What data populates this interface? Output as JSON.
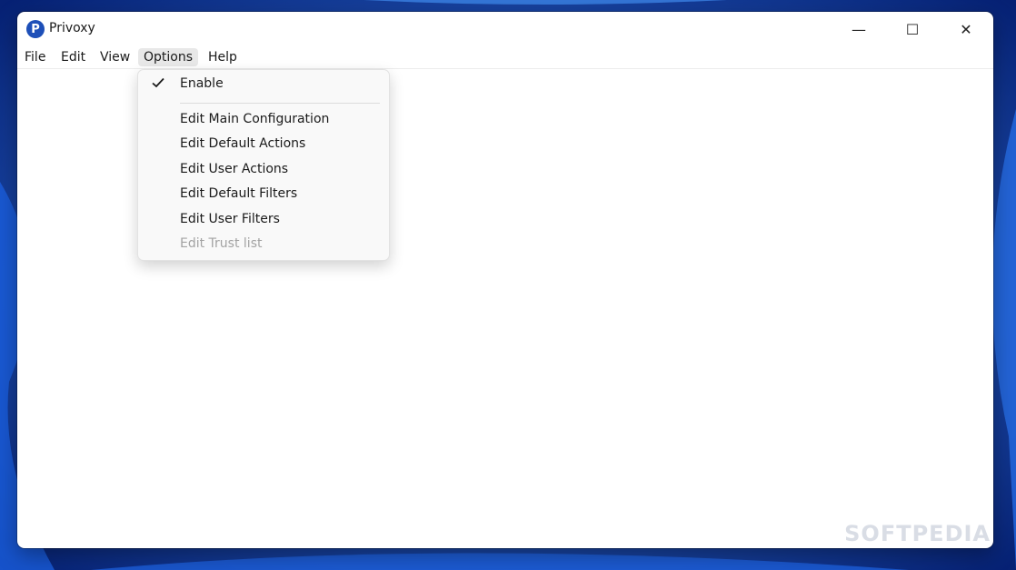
{
  "window": {
    "title": "Privoxy",
    "icon_letter": "P",
    "minimize_glyph": "—",
    "maximize_glyph": "☐",
    "close_glyph": "✕"
  },
  "menubar": {
    "items": [
      "File",
      "Edit",
      "View",
      "Options",
      "Help"
    ],
    "active": "Options"
  },
  "options_menu": {
    "items": [
      {
        "label": "Enable",
        "checked": true,
        "enabled": true
      },
      {
        "label": "Edit Main Configuration",
        "enabled": true
      },
      {
        "label": "Edit Default Actions",
        "enabled": true
      },
      {
        "label": "Edit User Actions",
        "enabled": true
      },
      {
        "label": "Edit Default Filters",
        "enabled": true
      },
      {
        "label": "Edit User Filters",
        "enabled": true
      },
      {
        "label": "Edit Trust list",
        "enabled": false
      }
    ]
  },
  "watermark": "SOFTPEDIA",
  "colors": {
    "accent": "#1d4fb8",
    "disabled_text": "#a3a3a3"
  }
}
